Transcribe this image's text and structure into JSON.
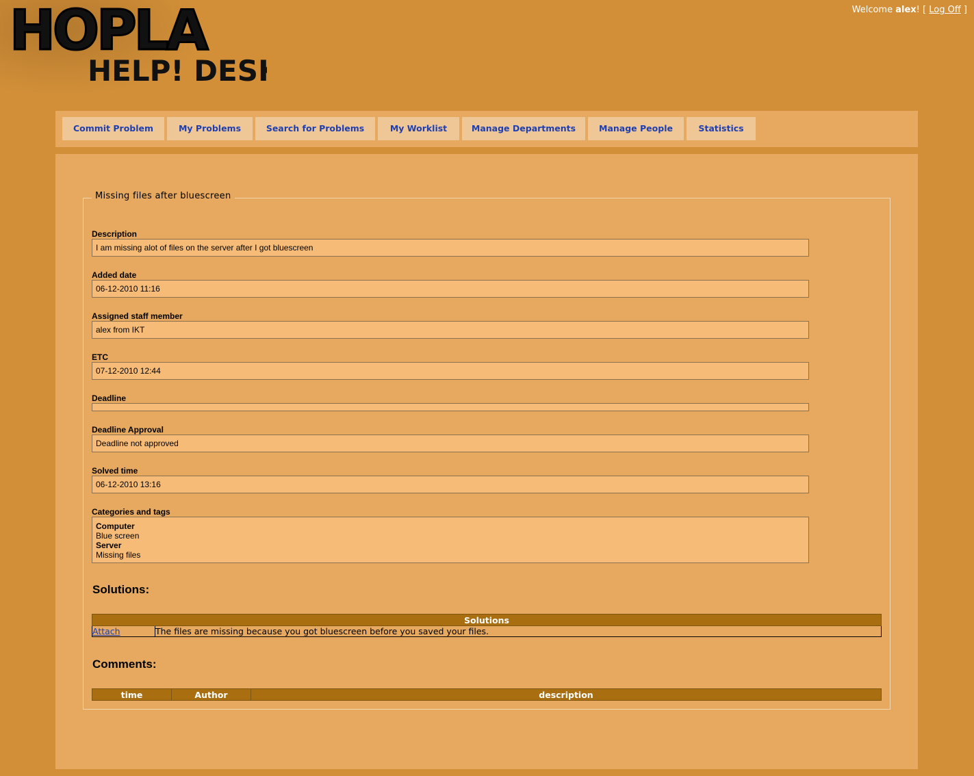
{
  "header": {
    "logo_top": "HOPLA",
    "logo_bottom": "HELP! DESK",
    "welcome_prefix": "Welcome",
    "username": "alex",
    "welcome_suffix": "! [",
    "logoff_label": "Log Off",
    "bracket_close": "]"
  },
  "nav": {
    "items": [
      {
        "label": "Commit Problem"
      },
      {
        "label": "My Problems"
      },
      {
        "label": "Search for Problems"
      },
      {
        "label": "My Worklist"
      },
      {
        "label": "Manage Departments"
      },
      {
        "label": "Manage People"
      },
      {
        "label": "Statistics"
      }
    ]
  },
  "problem": {
    "title": "Missing files after bluescreen",
    "fields": [
      {
        "label": "Description",
        "value": "I am missing alot of files on the server after I got bluescreen"
      },
      {
        "label": "Added date",
        "value": "06-12-2010 11:16"
      },
      {
        "label": "Assigned staff member",
        "value": "alex from IKT"
      },
      {
        "label": "ETC",
        "value": "07-12-2010 12:44"
      },
      {
        "label": "Deadline",
        "value": ""
      },
      {
        "label": "Deadline Approval",
        "value": "Deadline not approved"
      },
      {
        "label": "Solved time",
        "value": "06-12-2010 13:16"
      }
    ],
    "categories_label": "Categories and tags",
    "categories": [
      {
        "category": "Computer",
        "tag": "Blue screen"
      },
      {
        "category": "Server",
        "tag": "Missing files"
      }
    ]
  },
  "solutions": {
    "heading": "Solutions:",
    "table_header": "Solutions",
    "rows": [
      {
        "action": "Attach",
        "text": "The files are missing because you got bluescreen before you saved your files."
      }
    ]
  },
  "comments": {
    "heading": "Comments:",
    "columns": [
      "time",
      "Author",
      "description"
    ]
  },
  "colors": {
    "page_bg": "#d28f38",
    "panel_bg": "#e6a95f",
    "field_bg": "#f6bb76",
    "tab_bg": "#efc796",
    "link": "#1f3fb0",
    "table_header": "#a86e10"
  }
}
